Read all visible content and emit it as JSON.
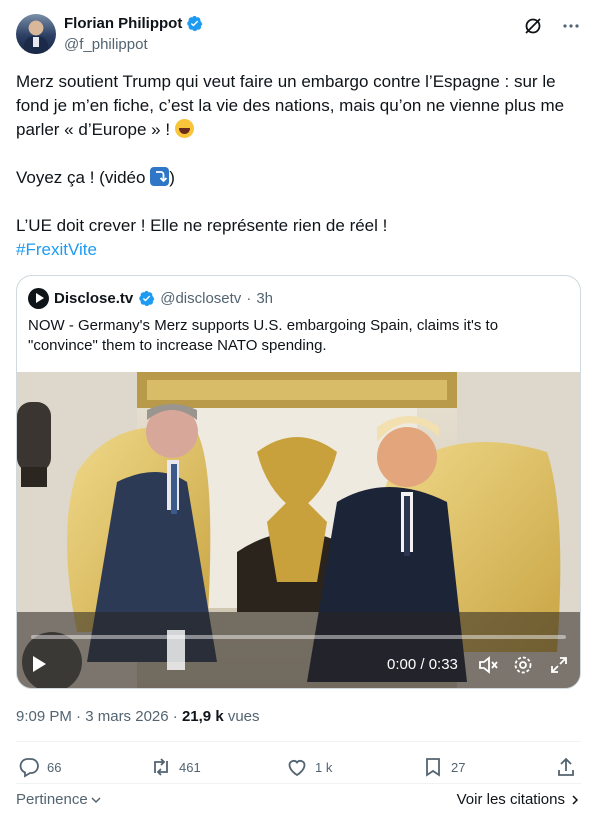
{
  "author": {
    "display_name": "Florian Philippot",
    "handle": "@f_philippot"
  },
  "tweet": {
    "line1": "Merz soutient Trump qui veut faire un embargo contre l’Espagne : sur le fond je m’en fiche, c’est la vie des nations, mais qu’on ne vienne plus me parler « d’Europe » ! ",
    "line2a": "Voyez ça ! (vidéo ",
    "line2b": ")",
    "line3": "L’UE doit crever ! Elle ne représente rien de réel !",
    "hashtag": "#FrexitVite"
  },
  "quote": {
    "name": "Disclose.tv",
    "handle": "@disclosetv",
    "separator": "·",
    "age": "3h",
    "text": "NOW - Germany's Merz supports U.S. embargoing Spain, claims it's to \"convince\" them to increase NATO spending."
  },
  "video": {
    "time": "0:00 / 0:33",
    "progress": 0
  },
  "meta": {
    "time": "9:09 PM",
    "sep1": "·",
    "date": "3 mars 2026",
    "sep2": "·",
    "views_count": "21,9 k",
    "views_label": "vues"
  },
  "actions": {
    "replies": "66",
    "reposts": "461",
    "likes": "1 k",
    "bookmarks": "27"
  },
  "footer": {
    "pertinence": "Pertinence",
    "citations": "Voir les citations"
  },
  "colors": {
    "accent": "#1d9bf0",
    "text": "#0f1419",
    "muted": "#536471",
    "border": "#cfd9de"
  }
}
